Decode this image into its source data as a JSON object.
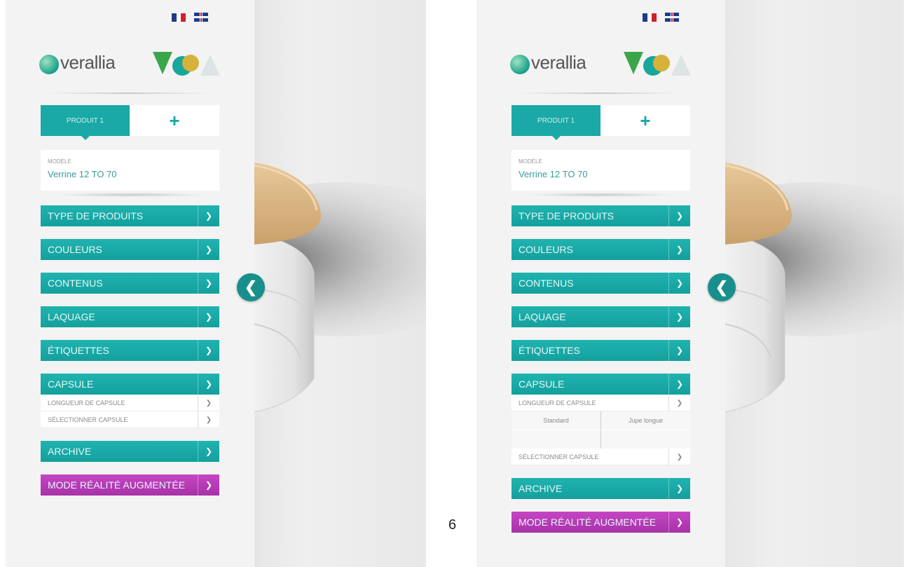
{
  "flags": [
    "fr-flag",
    "uk-flag"
  ],
  "logo": {
    "text": "verallia"
  },
  "tabs": {
    "product": "PRODUIT 1",
    "add": "+"
  },
  "model": {
    "label": "MODÈLE",
    "value": "Verrine 12 TO 70"
  },
  "menu": {
    "type_produits": "TYPE DE PRODUITS",
    "couleurs": "COULEURS",
    "contenus": "CONTENUS",
    "laquage": "LAQUAGE",
    "etiquettes": "ÉTIQUETTES",
    "capsule": "CAPSULE",
    "longueur_capsule": "LONGUEUR DE CAPSULE",
    "selectionner_capsule": "SÉLECTIONNER CAPSULE",
    "archive": "ARCHIVE",
    "mode_realite": "MODE RÉALITÉ AUGMENTÉE"
  },
  "capsule_options": {
    "standard": "Standard",
    "jupe_longue": "Jupe longue"
  },
  "page_number": "6",
  "colors": {
    "teal": "#1aa9a6",
    "magenta": "#b63bb6",
    "lid": "#dcb784"
  },
  "icons": {
    "toggle": "chevron-left-icon",
    "dropdown": "chevron-down-icon"
  }
}
